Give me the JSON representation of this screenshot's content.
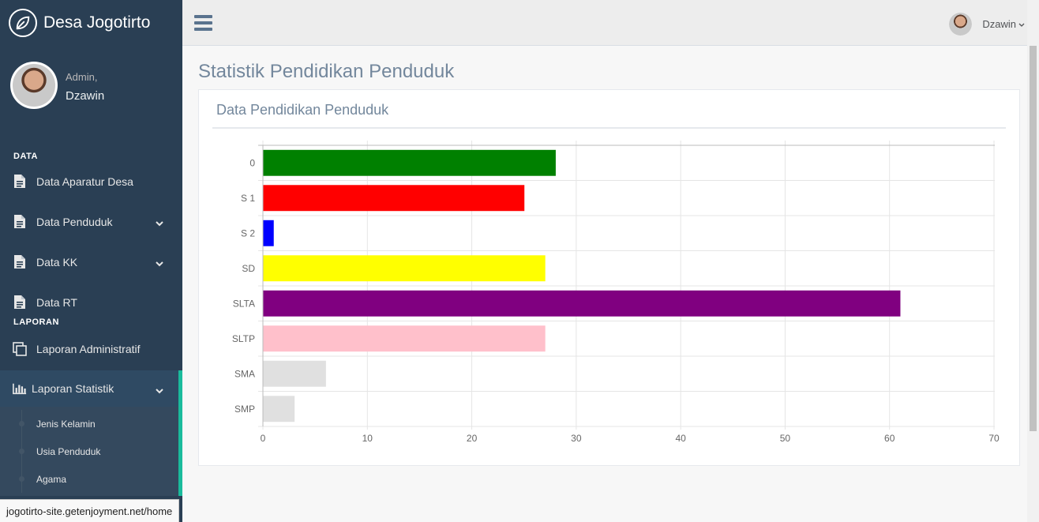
{
  "app": {
    "brand": "Desa Jogotirto"
  },
  "profile": {
    "welcome": "Admin,",
    "name": "Dzawin"
  },
  "sidebar": {
    "section_data": "DATA",
    "section_laporan": "LAPORAN",
    "items": [
      {
        "label": "Data Aparatur Desa",
        "icon": "file-icon",
        "chevron": false
      },
      {
        "label": "Data Penduduk",
        "icon": "file-icon",
        "chevron": true
      },
      {
        "label": "Data KK",
        "icon": "file-icon",
        "chevron": true
      },
      {
        "label": "Data RT",
        "icon": "file-icon",
        "chevron": false
      }
    ],
    "laporan_items": [
      {
        "label": "Laporan Administratif",
        "icon": "copy-icon"
      },
      {
        "label": "Laporan Statistik",
        "icon": "bar-chart-icon"
      }
    ],
    "submenu": [
      "Jenis Kelamin",
      "Usia Penduduk",
      "Agama"
    ]
  },
  "topnav": {
    "user": "Dzawin",
    "chevron": "⌄"
  },
  "page": {
    "title": "Statistik Pendidikan Penduduk",
    "panel_title": "Data Pendidikan Penduduk"
  },
  "chart_data": {
    "type": "bar",
    "orientation": "horizontal",
    "categories": [
      "0",
      "S 1",
      "S 2",
      "SD",
      "SLTA",
      "SLTP",
      "SMA",
      "SMP"
    ],
    "values": [
      28,
      25,
      1,
      27,
      61,
      27,
      6,
      3
    ],
    "colors": [
      "#008000",
      "#ff0000",
      "#0000ff",
      "#ffff00",
      "#800080",
      "#ffc0cb",
      "#e0e0e0",
      "#e0e0e0"
    ],
    "xlim": [
      0,
      70
    ],
    "xticks": [
      0,
      10,
      20,
      30,
      40,
      50,
      60,
      70
    ],
    "grid": true
  },
  "statusbar": {
    "url": "jogotirto-site.getenjoyment.net/home"
  }
}
